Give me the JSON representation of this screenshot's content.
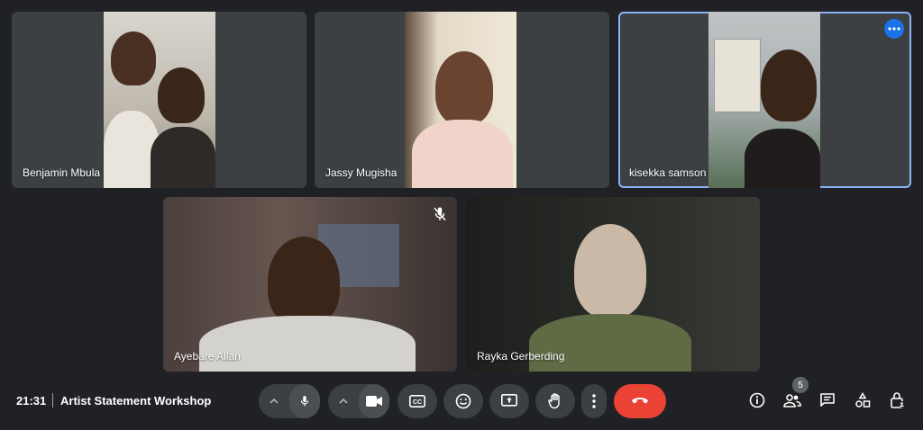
{
  "participants": [
    {
      "name": "Benjamin Mbula"
    },
    {
      "name": "Jassy Mugisha"
    },
    {
      "name": "kisekka samson"
    },
    {
      "name": "Ayebare Allan"
    },
    {
      "name": "Rayka Gerberding"
    }
  ],
  "toolbar": {
    "time": "21:31",
    "meeting_title": "Artist Statement Workshop",
    "participant_count": "5"
  },
  "colors": {
    "background": "#202124",
    "tile": "#3c4043",
    "active_outline": "#8ab4f8",
    "end_call": "#ea4335",
    "accent": "#1a73e8"
  },
  "icons": {
    "mic": "mic-icon",
    "camera": "camera-icon",
    "captions": "captions-icon",
    "emoji": "emoji-icon",
    "present": "present-icon",
    "raise_hand": "hand-icon",
    "more": "more-vert-icon",
    "end_call": "end-call-icon",
    "info": "info-icon",
    "people": "people-icon",
    "chat": "chat-icon",
    "activities": "activities-icon",
    "host_controls": "lock-person-icon"
  }
}
